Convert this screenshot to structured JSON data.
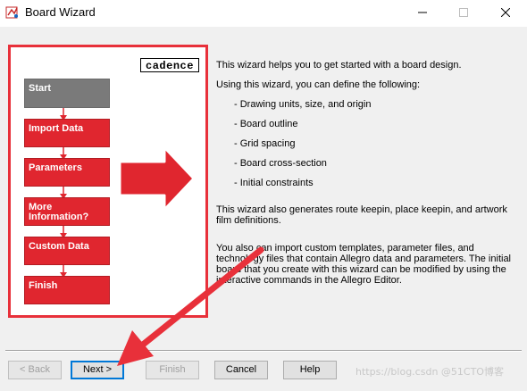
{
  "window": {
    "title": "Board Wizard",
    "icons": {
      "app": "app-icon",
      "minimize": "minimize-icon",
      "maximize": "maximize-icon",
      "close": "close-icon"
    }
  },
  "left_panel": {
    "logo_text": "cadence",
    "steps": [
      {
        "label": "Start",
        "state": "active"
      },
      {
        "label": "Import Data",
        "state": "inactive"
      },
      {
        "label": "Parameters",
        "state": "inactive"
      },
      {
        "label": "More\nInformation?",
        "state": "inactive"
      },
      {
        "label": "Custom Data",
        "state": "inactive"
      },
      {
        "label": "Finish",
        "state": "inactive"
      }
    ]
  },
  "content": {
    "intro": "This wizard helps you to get started with a board design.",
    "using": "Using this wizard, you can define the following:",
    "items": [
      "- Drawing units, size, and origin",
      "- Board outline",
      "- Grid spacing",
      "- Board cross-section",
      "- Initial constraints"
    ],
    "keepin_line1": "This wizard also generates route keepin, place keepin, and artwork",
    "keepin_line2": "film definitions.",
    "import_line1": "You also can import custom templates, parameter files, and",
    "import_line2": "technology files that contain Allegro data and parameters. The initial",
    "import_line3": "board that you create with this wizard can be modified by using the",
    "import_line4": "interactive commands in the Allegro Editor."
  },
  "buttons": {
    "back": "< Back",
    "next": "Next >",
    "finish": "Finish",
    "cancel": "Cancel",
    "help": "Help"
  },
  "watermark": "https://blog.csdn @51CTO博客",
  "colors": {
    "accent_red": "#e0262f",
    "active_step": "#7a7a7a",
    "annotation_arrow": "#e8303a",
    "focus_blue": "#0078d7"
  }
}
